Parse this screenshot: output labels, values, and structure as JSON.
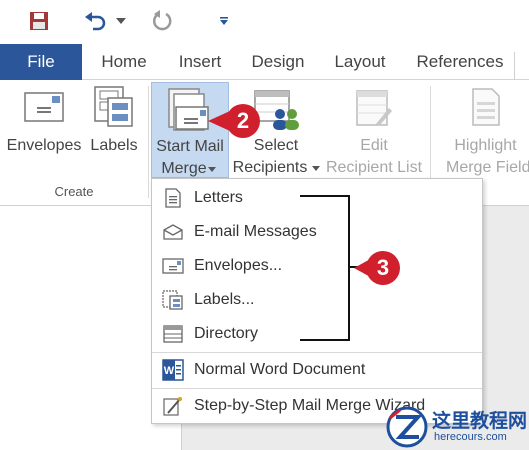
{
  "quick_access": {
    "icons": [
      "save-icon",
      "undo-icon",
      "dropdown-arrow-icon",
      "redo-icon",
      "customize-qat-icon"
    ]
  },
  "tabs": [
    {
      "label": "File"
    },
    {
      "label": "Home"
    },
    {
      "label": "Insert"
    },
    {
      "label": "Design"
    },
    {
      "label": "Layout"
    },
    {
      "label": "References"
    }
  ],
  "ribbon": {
    "create_group": {
      "label": "Create",
      "envelopes_label": "Envelopes",
      "labels_label": "Labels"
    },
    "start_mail_merge": {
      "line1": "Start Mail",
      "line2": "Merge"
    },
    "select_recipients": {
      "line1": "Select",
      "line2": "Recipients"
    },
    "edit_recipient_list": {
      "line1": "Edit",
      "line2": "Recipient List"
    },
    "highlight_merge_fields": {
      "line1": "Highlight",
      "line2": "Merge Field"
    }
  },
  "menu": {
    "items": [
      {
        "label": "Letters",
        "icon": "letter-icon"
      },
      {
        "label": "E-mail Messages",
        "icon": "email-icon"
      },
      {
        "label": "Envelopes...",
        "icon": "envelope-icon"
      },
      {
        "label": "Labels...",
        "icon": "labels-icon"
      },
      {
        "label": "Directory",
        "icon": "directory-icon"
      },
      {
        "label": "Normal Word Document",
        "icon": "word-document-icon"
      },
      {
        "label": "Step-by-Step Mail Merge Wizard",
        "icon": "wizard-icon"
      }
    ]
  },
  "callouts": {
    "step2": "2",
    "step3": "3"
  },
  "watermark": {
    "line1": "这里教程网",
    "line2": "herecours.com"
  },
  "colors": {
    "accent": "#2b579a",
    "active_button": "#c5d9f1",
    "callout": "#d0202d"
  }
}
